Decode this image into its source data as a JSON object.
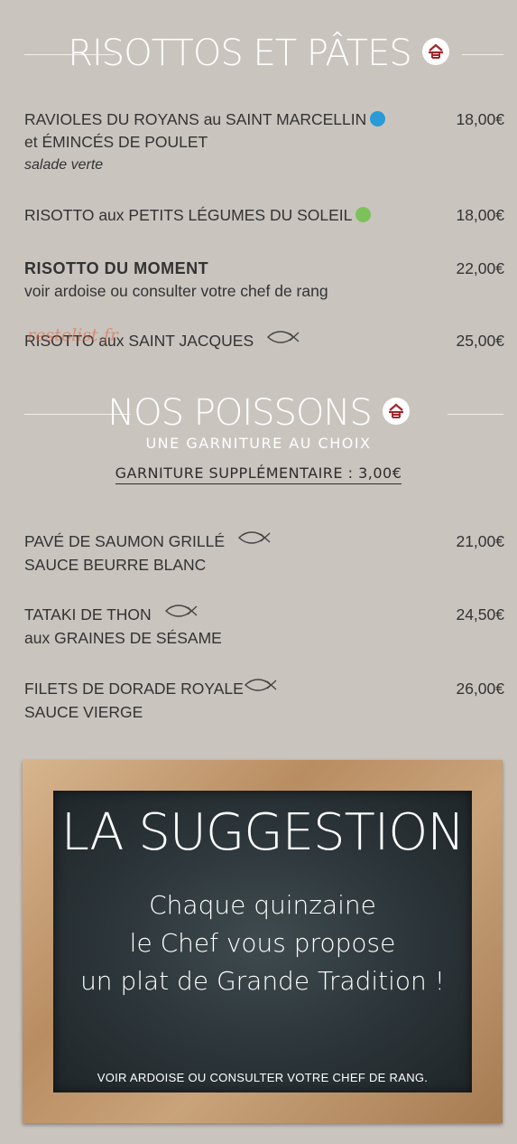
{
  "section1": {
    "title": "RISOTTOS ET PÂTES",
    "icon": "house-icon"
  },
  "items1": [
    {
      "name": "RAVIOLES DU ROYANS au SAINT MARCELLIN",
      "name2": "et ÉMINCÉS DE POULET",
      "sub": "salade verte",
      "price": "18,00€",
      "badge": "blue-badge-icon"
    },
    {
      "name": "RISOTTO aux PETITS LÉGUMES DU SOLEIL",
      "price": "18,00€",
      "badge": "green-vegetarian-icon"
    },
    {
      "name": "RISOTTO DU MOMENT",
      "sub": "voir ardoise ou consulter votre chef de rang",
      "price": "22,00€"
    },
    {
      "name": "RISOTTO aux SAINT JACQUES",
      "price": "25,00€",
      "icon": "fish-icon"
    }
  ],
  "watermark": "restolist.fr",
  "section2": {
    "title": "NOS POISSONS",
    "icon": "house-icon",
    "subtitle": "UNE GARNITURE AU CHOIX",
    "extra": "GARNITURE SUPPLÉMENTAIRE : 3,00€"
  },
  "items2": [
    {
      "name": "PAVÉ DE SAUMON GRILLÉ",
      "sub": "SAUCE BEURRE BLANC",
      "price": "21,00€",
      "icon": "fish-icon"
    },
    {
      "name": "TATAKI DE THON",
      "sub": "aux GRAINES DE SÉSAME",
      "price": "24,50€",
      "icon": "fish-icon"
    },
    {
      "name": "FILETS DE DORADE ROYALE",
      "sub": "SAUCE VIERGE",
      "price": "26,00€",
      "icon": "fish-icon"
    }
  ],
  "suggestion": {
    "title": "LA SUGGESTION",
    "line1": "Chaque quinzaine",
    "line2": "le Chef vous propose",
    "line3": "un plat de Grande Tradition !",
    "footer": "VOIR ARDOISE OU CONSULTER VOTRE CHEF DE RANG."
  },
  "colors": {
    "background": "#c9c4be",
    "icon_red": "#a4262c",
    "board": "#2b3438",
    "frame": "#b98d62"
  }
}
